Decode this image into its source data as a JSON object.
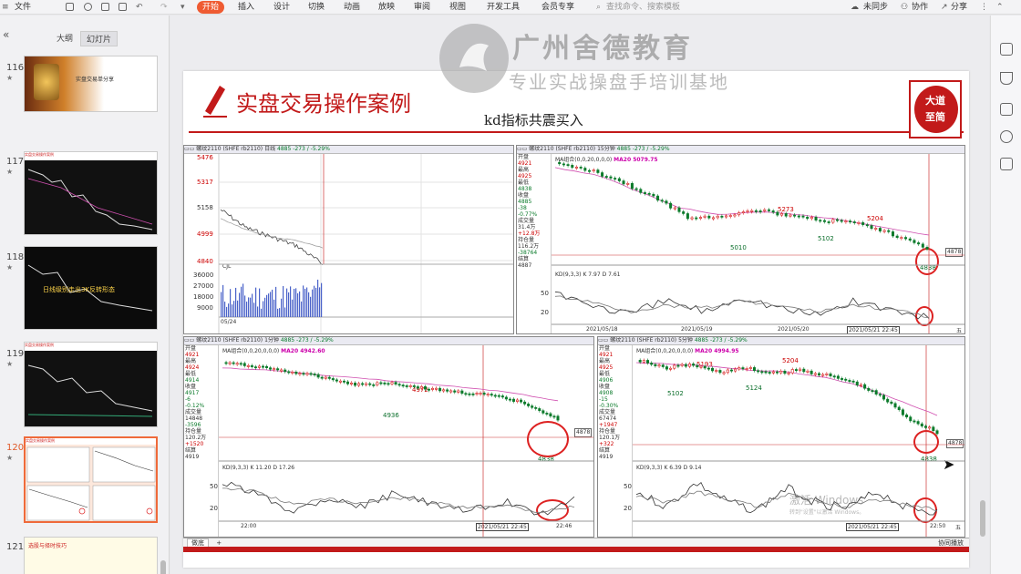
{
  "toolbar": {
    "file": "文件",
    "tabs": [
      "开始",
      "插入",
      "设计",
      "切换",
      "动画",
      "放映",
      "审阅",
      "视图",
      "开发工具",
      "会员专享"
    ],
    "search": "查找命令、搜索模板",
    "sync": "未同步",
    "collab": "协作",
    "share": "分享"
  },
  "panel": {
    "collapse": "«",
    "view_outline": "大纲",
    "view_slides": "幻灯片",
    "thumbs": [
      {
        "num": "116",
        "caption": "实盘交易单分享"
      },
      {
        "num": "117",
        "caption": "实盘交易操作案例"
      },
      {
        "num": "118",
        "caption": "日线级别走出3K反转形态"
      },
      {
        "num": "119",
        "caption": "实盘交易操作案例"
      },
      {
        "num": "120",
        "caption": "实盘交易操作案例"
      },
      {
        "num": "121",
        "caption": "选股与择时技巧"
      }
    ]
  },
  "watermark": {
    "line1": "广州舍德教育",
    "line2": "专业实战操盘手培训基地"
  },
  "slide": {
    "title": "实盘交易操作案例",
    "subtitle": "kd指标共震买入",
    "seal": [
      "大道",
      "至简"
    ],
    "activate": "激活 Windows",
    "activate_sub": "转到\"设置\"以激活 Windows。",
    "tabs": [
      "做底",
      "+"
    ],
    "bottom_right": "协同播放"
  },
  "colors": {
    "accent": "#ef5b32",
    "up": "#d41616",
    "down": "#0a7a2a",
    "ma20": "#d04fb0",
    "volume": "#4b63c9"
  },
  "sidepanel": [
    "开盘",
    "4921",
    "最高",
    "4925",
    "最低",
    "4838",
    "收盘",
    "4885",
    "-38",
    "-0.77%",
    "成交量",
    "31.4万",
    "+12.8万",
    "持仓量",
    "116.2万",
    "-38764",
    "结算",
    "4887"
  ],
  "charts": {
    "c1": {
      "header": [
        "螺纹2110",
        "(SHFE rb2110)",
        "日线",
        "4885",
        "-273 / -5.29%"
      ],
      "ylabels": [
        "5476",
        "5317",
        "5158",
        "4999",
        "4840"
      ],
      "vol_label": "CJL",
      "vol_ticks": [
        "36000",
        "27000",
        "18000",
        "9000"
      ],
      "xticks": [
        "05/24"
      ]
    },
    "c2": {
      "header": [
        "螺纹2110",
        "(SHFE rb2110)",
        "15分钟",
        "4885",
        "-273 / -5.29%"
      ],
      "ma": "MA组合(0,0,20,0,0,0)",
      "ma20": "MA20 5079.75",
      "kd": "KD(9,3,3)",
      "k": "K 7.97",
      "d": "D 7.61",
      "prices": [
        {
          "v": "5273",
          "c": "r"
        },
        {
          "v": "5204",
          "c": "r"
        },
        {
          "v": "5102",
          "c": "g"
        },
        {
          "v": "5010",
          "c": "g"
        },
        {
          "v": "4838",
          "c": "g"
        }
      ],
      "box": "4878",
      "kd_ticks": [
        "50",
        "20"
      ],
      "xticks": [
        "2021/05/18",
        "2021/05/19",
        "2021/05/20",
        "2021/05/21 22:45",
        "五"
      ]
    },
    "c3": {
      "header": [
        "螺纹2110",
        "(SHFE rb2110)",
        "1分钟",
        "4885",
        "-273 / -5.29%"
      ],
      "ma": "MA组合(0,0,20,0,0,0)",
      "ma20": "MA20 4942.60",
      "kd": "KD(9,3,3)",
      "k": "K 11.20",
      "d": "D 17.26",
      "prices": [
        {
          "v": "4972",
          "c": "r"
        },
        {
          "v": "4936",
          "c": "g"
        },
        {
          "v": "4838",
          "c": "g"
        }
      ],
      "box": "4878",
      "kd_ticks": [
        "50",
        "20"
      ],
      "side": [
        "开盘",
        "4921",
        "最高",
        "4924",
        "最低",
        "4914",
        "收盘",
        "4917",
        "-6",
        "-0.12%",
        "成交量",
        "14848",
        "-3596",
        "持仓量",
        "120.2万",
        "+1520",
        "结算",
        "4919"
      ],
      "xticks": [
        "22:00",
        "2021/05/21 22:45",
        "22:46"
      ]
    },
    "c4": {
      "header": [
        "螺纹2110",
        "(SHFE rb2110)",
        "5分钟",
        "4885",
        "-273 / -5.29%"
      ],
      "ma": "MA组合(0,0,20,0,0,0)",
      "ma20": "MA20 4994.95",
      "kd": "KD(9,3,3)",
      "k": "K 6.39",
      "d": "D 9.14",
      "prices": [
        {
          "v": "5193",
          "c": "r"
        },
        {
          "v": "5204",
          "c": "r"
        },
        {
          "v": "5102",
          "c": "g"
        },
        {
          "v": "5124",
          "c": "g"
        },
        {
          "v": "4838",
          "c": "g"
        }
      ],
      "box": "4878",
      "kd_ticks": [
        "50",
        "20"
      ],
      "side": [
        "开盘",
        "4921",
        "最高",
        "4925",
        "最低",
        "4906",
        "收盘",
        "4908",
        "-15",
        "-0.30%",
        "成交量",
        "67474",
        "+1947",
        "持仓量",
        "120.1万",
        "+322",
        "结算",
        "4919"
      ],
      "xticks": [
        "2021/05/21 22:45",
        "22:50",
        "五"
      ]
    }
  }
}
